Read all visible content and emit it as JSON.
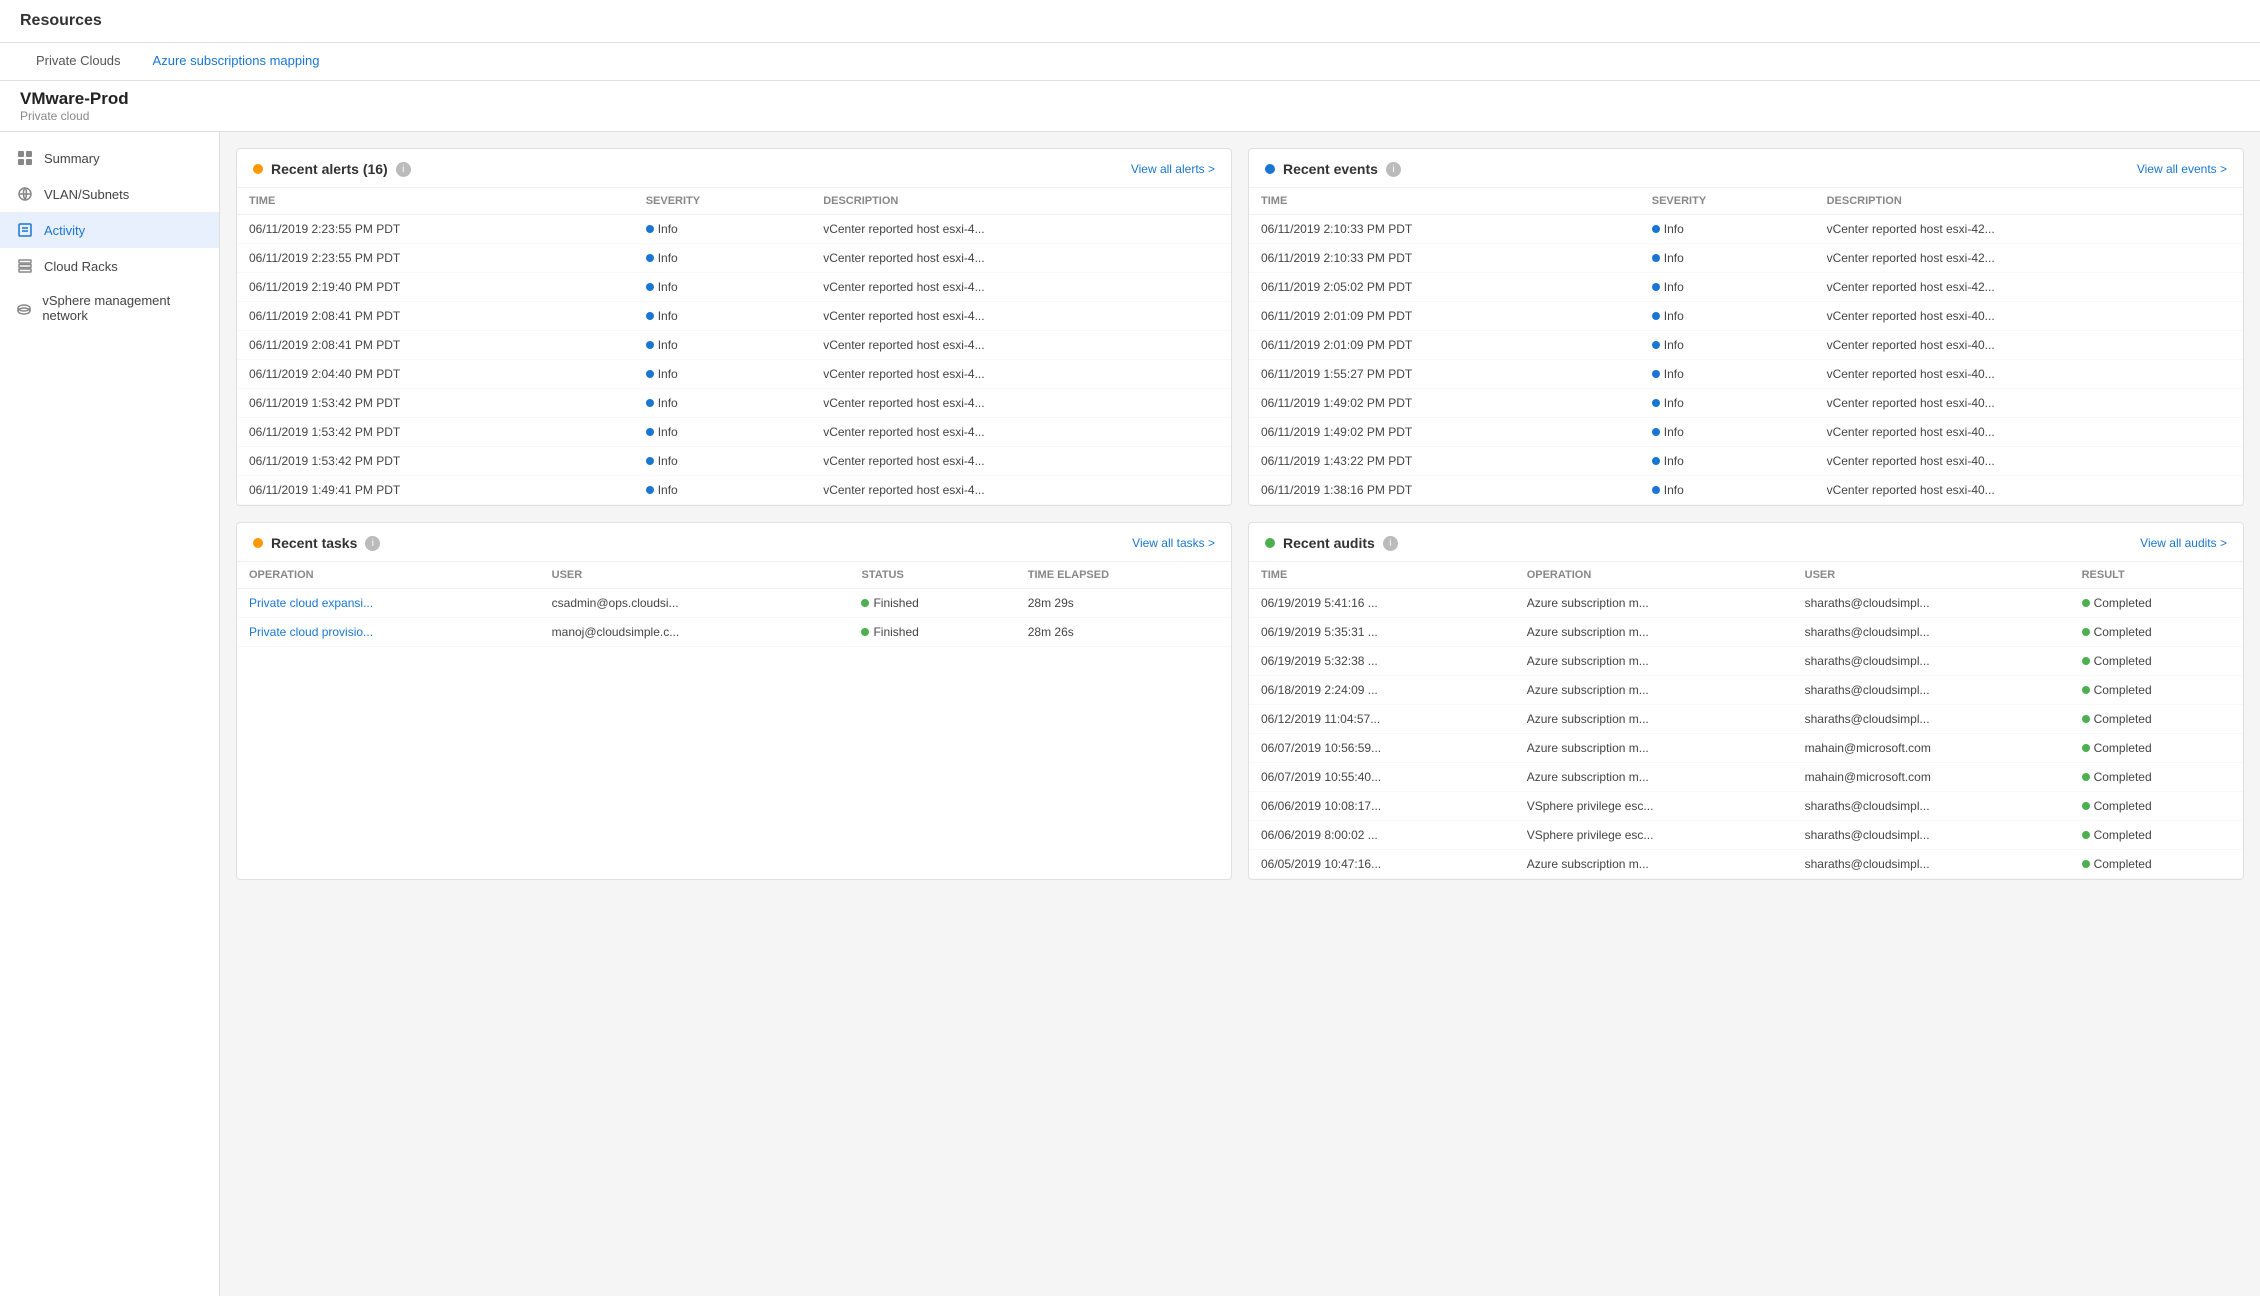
{
  "app": {
    "title": "Resources"
  },
  "tabs": [
    {
      "id": "private-clouds",
      "label": "Private Clouds",
      "active": true
    },
    {
      "id": "azure-subscriptions",
      "label": "Azure subscriptions mapping",
      "active": false
    }
  ],
  "cloud": {
    "name": "VMware-Prod",
    "type": "Private cloud"
  },
  "sidebar": {
    "items": [
      {
        "id": "summary",
        "label": "Summary",
        "icon": "grid-icon",
        "active": false
      },
      {
        "id": "vlan-subnets",
        "label": "VLAN/Subnets",
        "icon": "network-icon",
        "active": false
      },
      {
        "id": "activity",
        "label": "Activity",
        "icon": "activity-icon",
        "active": true
      },
      {
        "id": "cloud-racks",
        "label": "Cloud Racks",
        "icon": "rack-icon",
        "active": false
      },
      {
        "id": "vsphere-mgmt",
        "label": "vSphere management network",
        "icon": "vsphere-icon",
        "active": false
      }
    ]
  },
  "alerts_panel": {
    "title": "Recent alerts (16)",
    "dot_color": "#ff9800",
    "link_text": "View all alerts >",
    "columns": [
      "TIME",
      "SEVERITY",
      "DESCRIPTION"
    ],
    "rows": [
      {
        "time": "06/11/2019 2:23:55 PM PDT",
        "severity": "Info",
        "description": "vCenter reported host esxi-4..."
      },
      {
        "time": "06/11/2019 2:23:55 PM PDT",
        "severity": "Info",
        "description": "vCenter reported host esxi-4..."
      },
      {
        "time": "06/11/2019 2:19:40 PM PDT",
        "severity": "Info",
        "description": "vCenter reported host esxi-4..."
      },
      {
        "time": "06/11/2019 2:08:41 PM PDT",
        "severity": "Info",
        "description": "vCenter reported host esxi-4..."
      },
      {
        "time": "06/11/2019 2:08:41 PM PDT",
        "severity": "Info",
        "description": "vCenter reported host esxi-4..."
      },
      {
        "time": "06/11/2019 2:04:40 PM PDT",
        "severity": "Info",
        "description": "vCenter reported host esxi-4..."
      },
      {
        "time": "06/11/2019 1:53:42 PM PDT",
        "severity": "Info",
        "description": "vCenter reported host esxi-4..."
      },
      {
        "time": "06/11/2019 1:53:42 PM PDT",
        "severity": "Info",
        "description": "vCenter reported host esxi-4..."
      },
      {
        "time": "06/11/2019 1:53:42 PM PDT",
        "severity": "Info",
        "description": "vCenter reported host esxi-4..."
      },
      {
        "time": "06/11/2019 1:49:41 PM PDT",
        "severity": "Info",
        "description": "vCenter reported host esxi-4..."
      }
    ]
  },
  "events_panel": {
    "title": "Recent events",
    "dot_color": "#1976d2",
    "link_text": "View all events >",
    "columns": [
      "TIME",
      "SEVERITY",
      "DESCRIPTION"
    ],
    "rows": [
      {
        "time": "06/11/2019 2:10:33 PM PDT",
        "severity": "Info",
        "description": "vCenter reported host esxi-42..."
      },
      {
        "time": "06/11/2019 2:10:33 PM PDT",
        "severity": "Info",
        "description": "vCenter reported host esxi-42..."
      },
      {
        "time": "06/11/2019 2:05:02 PM PDT",
        "severity": "Info",
        "description": "vCenter reported host esxi-42..."
      },
      {
        "time": "06/11/2019 2:01:09 PM PDT",
        "severity": "Info",
        "description": "vCenter reported host esxi-40..."
      },
      {
        "time": "06/11/2019 2:01:09 PM PDT",
        "severity": "Info",
        "description": "vCenter reported host esxi-40..."
      },
      {
        "time": "06/11/2019 1:55:27 PM PDT",
        "severity": "Info",
        "description": "vCenter reported host esxi-40..."
      },
      {
        "time": "06/11/2019 1:49:02 PM PDT",
        "severity": "Info",
        "description": "vCenter reported host esxi-40..."
      },
      {
        "time": "06/11/2019 1:49:02 PM PDT",
        "severity": "Info",
        "description": "vCenter reported host esxi-40..."
      },
      {
        "time": "06/11/2019 1:43:22 PM PDT",
        "severity": "Info",
        "description": "vCenter reported host esxi-40..."
      },
      {
        "time": "06/11/2019 1:38:16 PM PDT",
        "severity": "Info",
        "description": "vCenter reported host esxi-40..."
      }
    ]
  },
  "tasks_panel": {
    "title": "Recent tasks",
    "dot_color": "#ff9800",
    "link_text": "View all tasks >",
    "columns": [
      "OPERATION",
      "USER",
      "STATUS",
      "TIME ELAPSED"
    ],
    "rows": [
      {
        "operation": "Private cloud expansi...",
        "user": "csadmin@ops.cloudsi...",
        "status": "Finished",
        "elapsed": "28m 29s"
      },
      {
        "operation": "Private cloud provisio...",
        "user": "manoj@cloudsimple.c...",
        "status": "Finished",
        "elapsed": "28m 26s"
      }
    ]
  },
  "audits_panel": {
    "title": "Recent audits",
    "dot_color": "#4caf50",
    "link_text": "View all audits >",
    "columns": [
      "TIME",
      "OPERATION",
      "USER",
      "RESULT"
    ],
    "rows": [
      {
        "time": "06/19/2019 5:41:16 ...",
        "operation": "Azure subscription m...",
        "user": "sharaths@cloudsimpl...",
        "result": "Completed"
      },
      {
        "time": "06/19/2019 5:35:31 ...",
        "operation": "Azure subscription m...",
        "user": "sharaths@cloudsimpl...",
        "result": "Completed"
      },
      {
        "time": "06/19/2019 5:32:38 ...",
        "operation": "Azure subscription m...",
        "user": "sharaths@cloudsimpl...",
        "result": "Completed"
      },
      {
        "time": "06/18/2019 2:24:09 ...",
        "operation": "Azure subscription m...",
        "user": "sharaths@cloudsimpl...",
        "result": "Completed"
      },
      {
        "time": "06/12/2019 11:04:57...",
        "operation": "Azure subscription m...",
        "user": "sharaths@cloudsimpl...",
        "result": "Completed"
      },
      {
        "time": "06/07/2019 10:56:59...",
        "operation": "Azure subscription m...",
        "user": "mahain@microsoft.com",
        "result": "Completed"
      },
      {
        "time": "06/07/2019 10:55:40...",
        "operation": "Azure subscription m...",
        "user": "mahain@microsoft.com",
        "result": "Completed"
      },
      {
        "time": "06/06/2019 10:08:17...",
        "operation": "VSphere privilege esc...",
        "user": "sharaths@cloudsimpl...",
        "result": "Completed"
      },
      {
        "time": "06/06/2019 8:00:02 ...",
        "operation": "VSphere privilege esc...",
        "user": "sharaths@cloudsimpl...",
        "result": "Completed"
      },
      {
        "time": "06/05/2019 10:47:16...",
        "operation": "Azure subscription m...",
        "user": "sharaths@cloudsimpl...",
        "result": "Completed"
      }
    ]
  }
}
